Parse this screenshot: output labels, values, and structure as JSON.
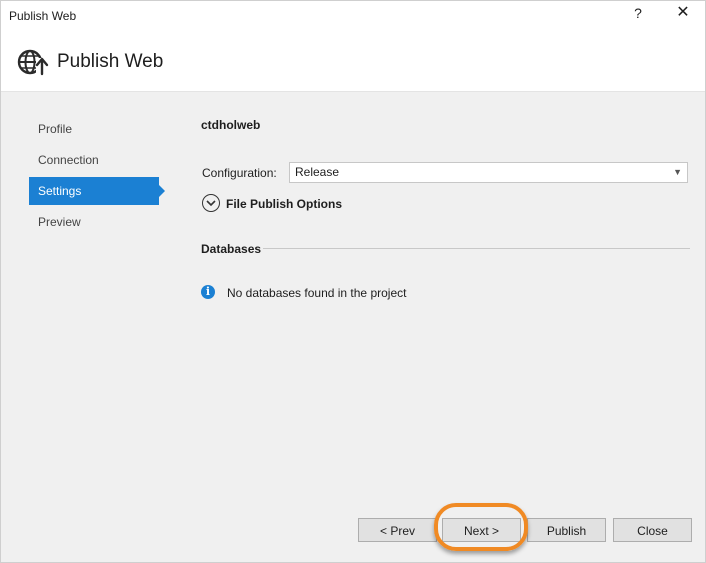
{
  "window": {
    "title": "Publish Web",
    "help_glyph": "?",
    "close_glyph": "✕"
  },
  "header": {
    "title": "Publish Web",
    "icon": "globe-publish-icon"
  },
  "nav": {
    "items": [
      {
        "label": "Profile",
        "active": false
      },
      {
        "label": "Connection",
        "active": false
      },
      {
        "label": "Settings",
        "active": true
      },
      {
        "label": "Preview",
        "active": false
      }
    ]
  },
  "settings": {
    "profile_name": "ctdholweb",
    "configuration_label": "Configuration:",
    "configuration_value": "Release",
    "file_publish_options_label": "File Publish Options",
    "databases_label": "Databases",
    "no_databases_message": "No databases found in the project"
  },
  "buttons": {
    "prev": "< Prev",
    "next": "Next >",
    "publish": "Publish",
    "close": "Close"
  },
  "colors": {
    "accent": "#1b80d3",
    "highlight": "#f08a24"
  }
}
